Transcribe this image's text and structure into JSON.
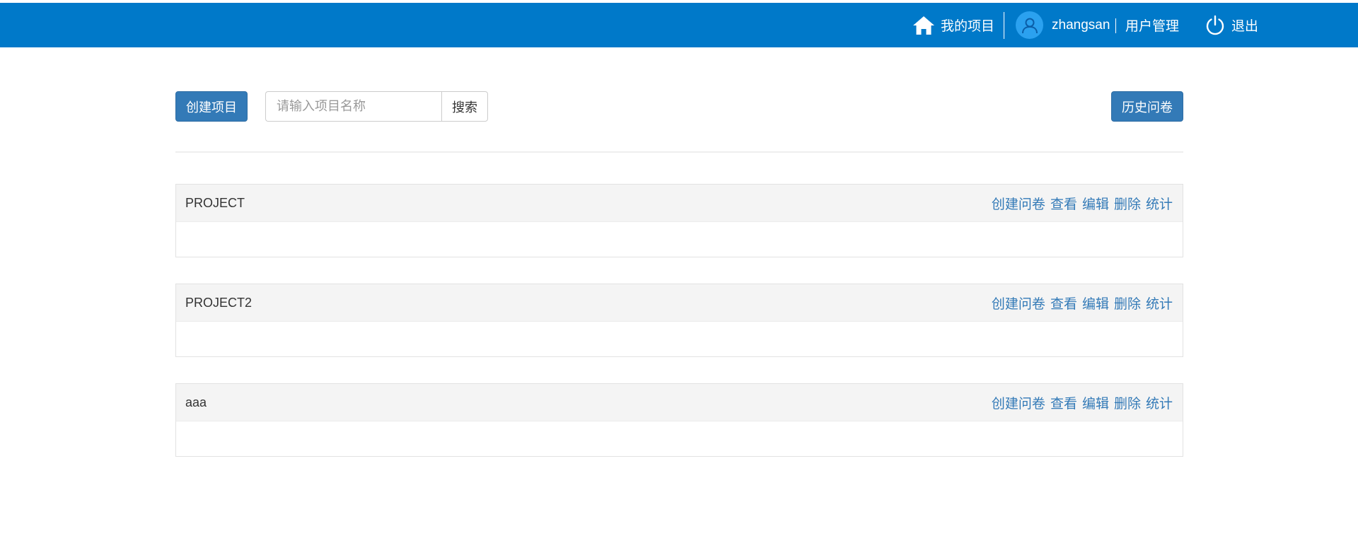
{
  "header": {
    "my_projects": "我的项目",
    "username": "zhangsan",
    "user_management": "用户管理",
    "logout": "退出",
    "bar_color": "#0079C9"
  },
  "toolbar": {
    "create_project": "创建项目",
    "search_placeholder": "请输入项目名称",
    "search_value": "",
    "search_button": "搜索",
    "history_surveys": "历史问卷"
  },
  "projects": [
    {
      "name": "PROJECT",
      "actions": [
        "创建问卷",
        "查看",
        "编辑",
        "删除",
        "统计"
      ]
    },
    {
      "name": "PROJECT2",
      "actions": [
        "创建问卷",
        "查看",
        "编辑",
        "删除",
        "统计"
      ]
    },
    {
      "name": "aaa",
      "actions": [
        "创建问卷",
        "查看",
        "编辑",
        "删除",
        "统计"
      ]
    }
  ],
  "icons": {
    "home": "home-icon",
    "user": "user-icon",
    "power": "power-icon"
  }
}
